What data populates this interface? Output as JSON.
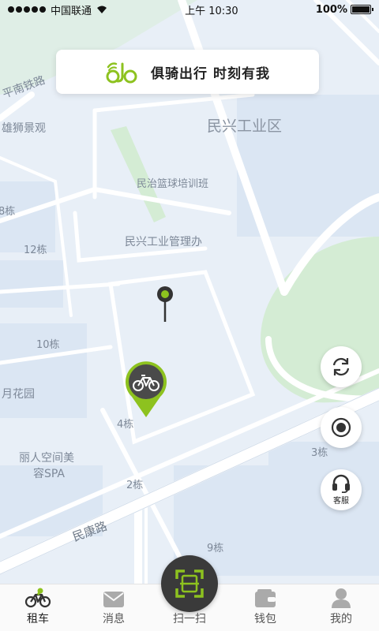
{
  "status_bar": {
    "carrier": "中国联通",
    "time": "上午 10:30",
    "battery": "100%"
  },
  "banner": {
    "slogan": "俱骑出行 时刻有我",
    "logo_icon": "bike-wheels-logo-icon"
  },
  "map": {
    "labels": {
      "district": "民兴工业区",
      "landmark_1": "雄狮景观",
      "landmark_2": "民治篮球培训班",
      "landmark_3": "民兴工业管理办",
      "building_12": "12栋",
      "building_10": "10栋",
      "building_8": "8栋",
      "building_4": "4栋",
      "building_3": "3栋",
      "building_2": "2栋",
      "building_9": "9栋",
      "garden": "月花园",
      "spa_1": "丽人空间美",
      "spa_2": "容SPA",
      "road_1": "民康路",
      "road_2": "平南铁路"
    },
    "colors": {
      "background": "#e8eff7",
      "road": "#ffffff",
      "park": "#d4ecd4",
      "accent": "#8dc21f"
    }
  },
  "controls": {
    "refresh_icon": "refresh-icon",
    "locate_icon": "locate-icon",
    "service_label": "客服"
  },
  "tabs": [
    {
      "label": "租车",
      "icon": "bike-icon",
      "active": true
    },
    {
      "label": "消息",
      "icon": "message-icon",
      "active": false
    },
    {
      "label": "扫一扫",
      "icon": "scan-icon",
      "active": false
    },
    {
      "label": "钱包",
      "icon": "wallet-icon",
      "active": false
    },
    {
      "label": "我的",
      "icon": "user-icon",
      "active": false
    }
  ]
}
